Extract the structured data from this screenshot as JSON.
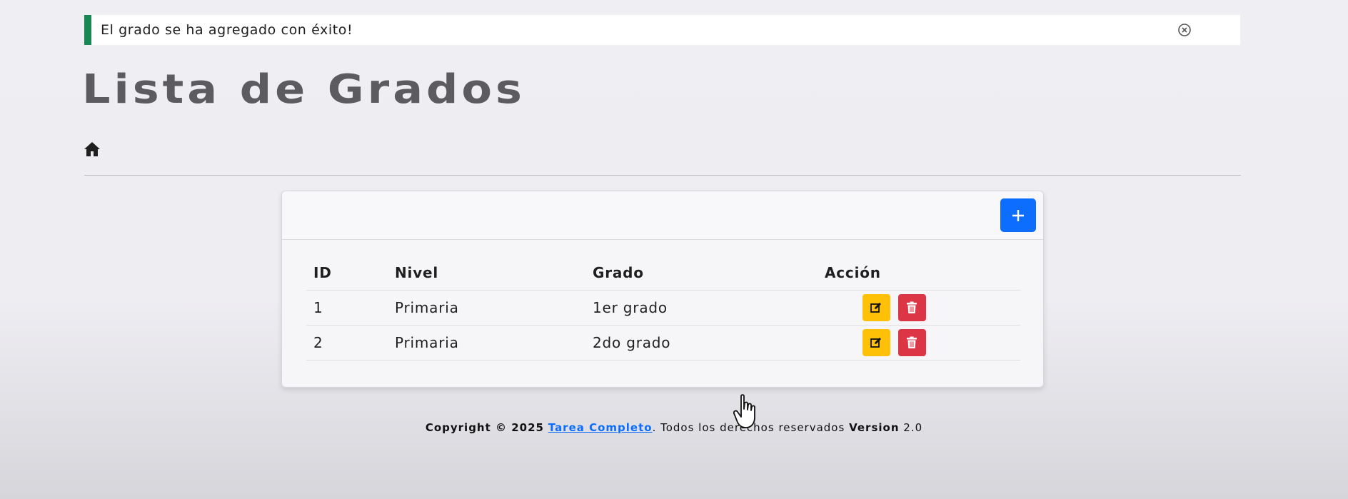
{
  "alert": {
    "message": "El grado se ha agregado con éxito!",
    "accent_color": "#198754",
    "close_icon": "circle-x-icon"
  },
  "page": {
    "title": "Lista de Grados",
    "home_icon": "home-icon"
  },
  "card": {
    "add_icon": "plus-icon",
    "add_color": "#0d6efd"
  },
  "table": {
    "headers": {
      "id": "ID",
      "nivel": "Nivel",
      "grado": "Grado",
      "accion": "Acción"
    },
    "rows": [
      {
        "id": "1",
        "nivel": "Primaria",
        "grado": "1er grado"
      },
      {
        "id": "2",
        "nivel": "Primaria",
        "grado": "2do grado"
      }
    ],
    "edit_icon": "edit-icon",
    "edit_color": "#ffc107",
    "delete_icon": "trash-icon",
    "delete_color": "#dc3545"
  },
  "footer": {
    "copyright": "Copyright © 2025",
    "link": "Tarea Completo",
    "rights": ". Todos los derechos reservados",
    "version_label": "Version",
    "version": "2.0"
  }
}
